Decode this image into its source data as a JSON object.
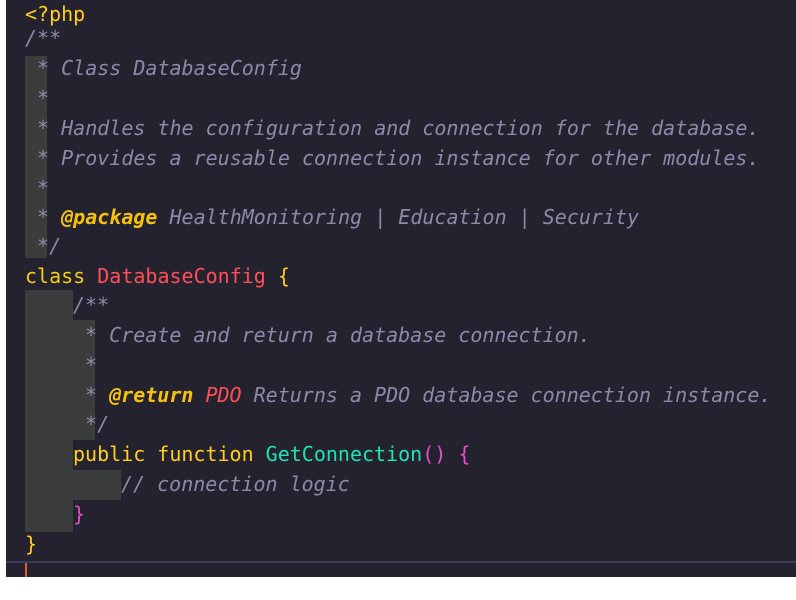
{
  "editor": {
    "language": "php",
    "colors": {
      "background": "#25222f",
      "comment": "#8c8aa8",
      "doc_tag": "#f6c20e",
      "doc_type": "#ff4f58",
      "keyword": "#f3ce12",
      "class_name": "#ff4f58",
      "function_name": "#20e3b2",
      "brace_outer": "#ffce20",
      "brace_inner": "#e051c6",
      "cursor": "#e65a2a"
    },
    "lines": {
      "l1": {
        "open_tag": "<?php"
      },
      "l2": {
        "comment": "/**"
      },
      "l3": {
        "comment": " * Class DatabaseConfig"
      },
      "l4": {
        "comment": " *"
      },
      "l5": {
        "comment": " * Handles the configuration and connection for the database."
      },
      "l6": {
        "comment": " * Provides a reusable connection instance for other modules."
      },
      "l7": {
        "comment": " *"
      },
      "l8": {
        "prefix": " * ",
        "tag": "@package",
        "rest": " HealthMonitoring | Education | Security"
      },
      "l9": {
        "comment": " */"
      },
      "l10": {
        "keyword": "class",
        "name": "DatabaseConfig",
        "brace": "{"
      },
      "l11": {
        "comment": "/**"
      },
      "l12": {
        "comment": " * Create and return a database connection."
      },
      "l13": {
        "comment": " *"
      },
      "l14": {
        "prefix": " * ",
        "tag": "@return",
        "type": "PDO",
        "rest": " Returns a PDO database connection instance."
      },
      "l15": {
        "comment": " */"
      },
      "l16": {
        "modifier": "public",
        "keyword": "function",
        "name": "GetConnection",
        "parens": "()",
        "brace": "{"
      },
      "l17": {
        "comment": "// connection logic"
      },
      "l18": {
        "brace": "}"
      },
      "l19": {
        "brace": "}"
      }
    }
  }
}
